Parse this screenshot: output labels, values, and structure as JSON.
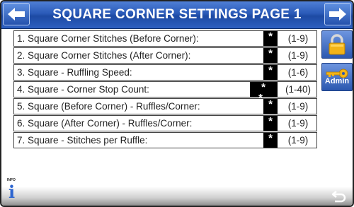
{
  "header": {
    "title": "SQUARE CORNER SETTINGS PAGE 1",
    "prev_icon": "arrow-left-icon",
    "next_icon": "arrow-right-icon"
  },
  "settings": [
    {
      "label": "1. Square Corner Stitches (Before Corner):",
      "value": "*",
      "range": "(1-9)"
    },
    {
      "label": "2. Square Corner Stitches (After Corner):",
      "value": "*",
      "range": "(1-9)"
    },
    {
      "label": "3. Square - Ruffling Speed:",
      "value": "*",
      "range": "(1-6)"
    },
    {
      "label": "4. Square - Corner Stop Count:",
      "value": "* *",
      "range": "(1-40)"
    },
    {
      "label": "5. Square (Before Corner) - Ruffles/Corner:",
      "value": "*",
      "range": "(1-9)"
    },
    {
      "label": "6. Square (After Corner) - Ruffles/Corner:",
      "value": "*",
      "range": "(1-9)"
    },
    {
      "label": "7. Square - Stitches per Ruffle:",
      "value": "*",
      "range": "(1-9)"
    }
  ],
  "side": {
    "lock_icon": "padlock-icon",
    "admin_label": "Admin",
    "admin_icon": "key-icon"
  },
  "footer": {
    "info_label": "INFO",
    "info_glyph": "i",
    "back_icon": "return-arrow-icon"
  },
  "colors": {
    "header_blue": "#2a5ab8",
    "value_box": "#000000",
    "lock_gold": "#f2b418"
  }
}
